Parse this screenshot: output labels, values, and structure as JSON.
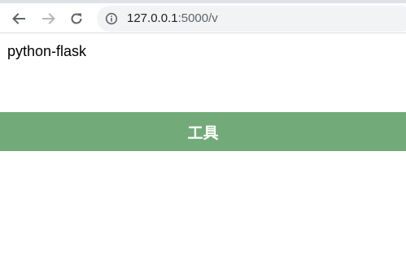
{
  "browser": {
    "back_icon": "arrow-left-icon",
    "forward_icon": "arrow-right-icon",
    "reload_icon": "reload-icon",
    "info_icon": "info-icon",
    "url_host": "127.0.0.1",
    "url_rest": ":5000/v"
  },
  "page": {
    "title": "python-flask",
    "banner_label": "工具",
    "banner_color": "#72ab79"
  }
}
